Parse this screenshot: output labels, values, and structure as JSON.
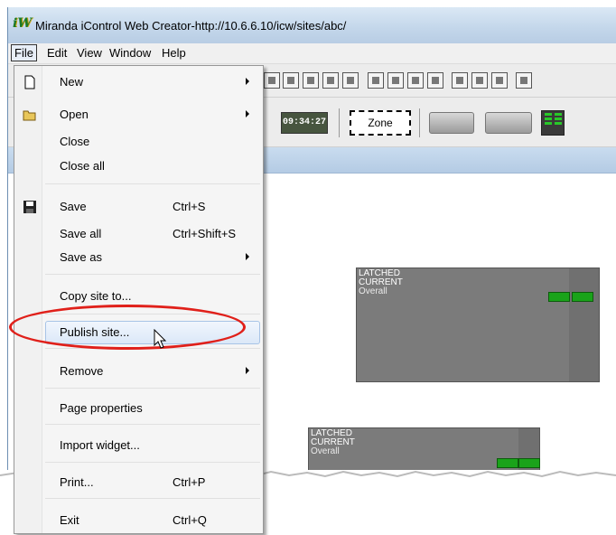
{
  "window": {
    "title": "Miranda iControl Web Creator-http://10.6.6.10/icw/sites/abc/"
  },
  "menubar": {
    "items": [
      "File",
      "Edit",
      "View",
      "Window",
      "Help"
    ]
  },
  "toolbar": {
    "clock_text": "09:34:27",
    "zone_label": "Zone"
  },
  "file_menu": {
    "items": [
      {
        "label": "New",
        "shortcut": "",
        "submenu": true,
        "icon": "new-page-icon"
      },
      {
        "label": "Open",
        "shortcut": "",
        "submenu": true,
        "icon": "open-folder-icon"
      },
      {
        "label": "Close",
        "shortcut": "",
        "submenu": false
      },
      {
        "label": "Close all",
        "shortcut": "",
        "submenu": false
      },
      {
        "label": "Save",
        "shortcut": "Ctrl+S",
        "submenu": false,
        "icon": "floppy-disk-icon"
      },
      {
        "label": "Save all",
        "shortcut": "Ctrl+Shift+S",
        "submenu": false
      },
      {
        "label": "Save as",
        "shortcut": "",
        "submenu": true
      },
      {
        "label": "Copy site to...",
        "shortcut": "",
        "submenu": false
      },
      {
        "label": "Publish site...",
        "shortcut": "",
        "submenu": false,
        "highlighted": true
      },
      {
        "label": "Remove",
        "shortcut": "",
        "submenu": true
      },
      {
        "label": "Page properties",
        "shortcut": "",
        "submenu": false
      },
      {
        "label": "Import widget...",
        "shortcut": "",
        "submenu": false
      },
      {
        "label": "Print...",
        "shortcut": "Ctrl+P",
        "submenu": false
      },
      {
        "label": "Exit",
        "shortcut": "Ctrl+Q",
        "submenu": false
      }
    ]
  },
  "widgets": [
    {
      "line1": "LATCHED",
      "line2": "CURRENT",
      "line3": "Overall"
    },
    {
      "line1": "LATCHED",
      "line2": "CURRENT",
      "line3": "Overall"
    }
  ],
  "colors": {
    "highlight_ellipse": "#e0201a",
    "led_green": "#1aa31a",
    "widget_gray": "#707070"
  }
}
